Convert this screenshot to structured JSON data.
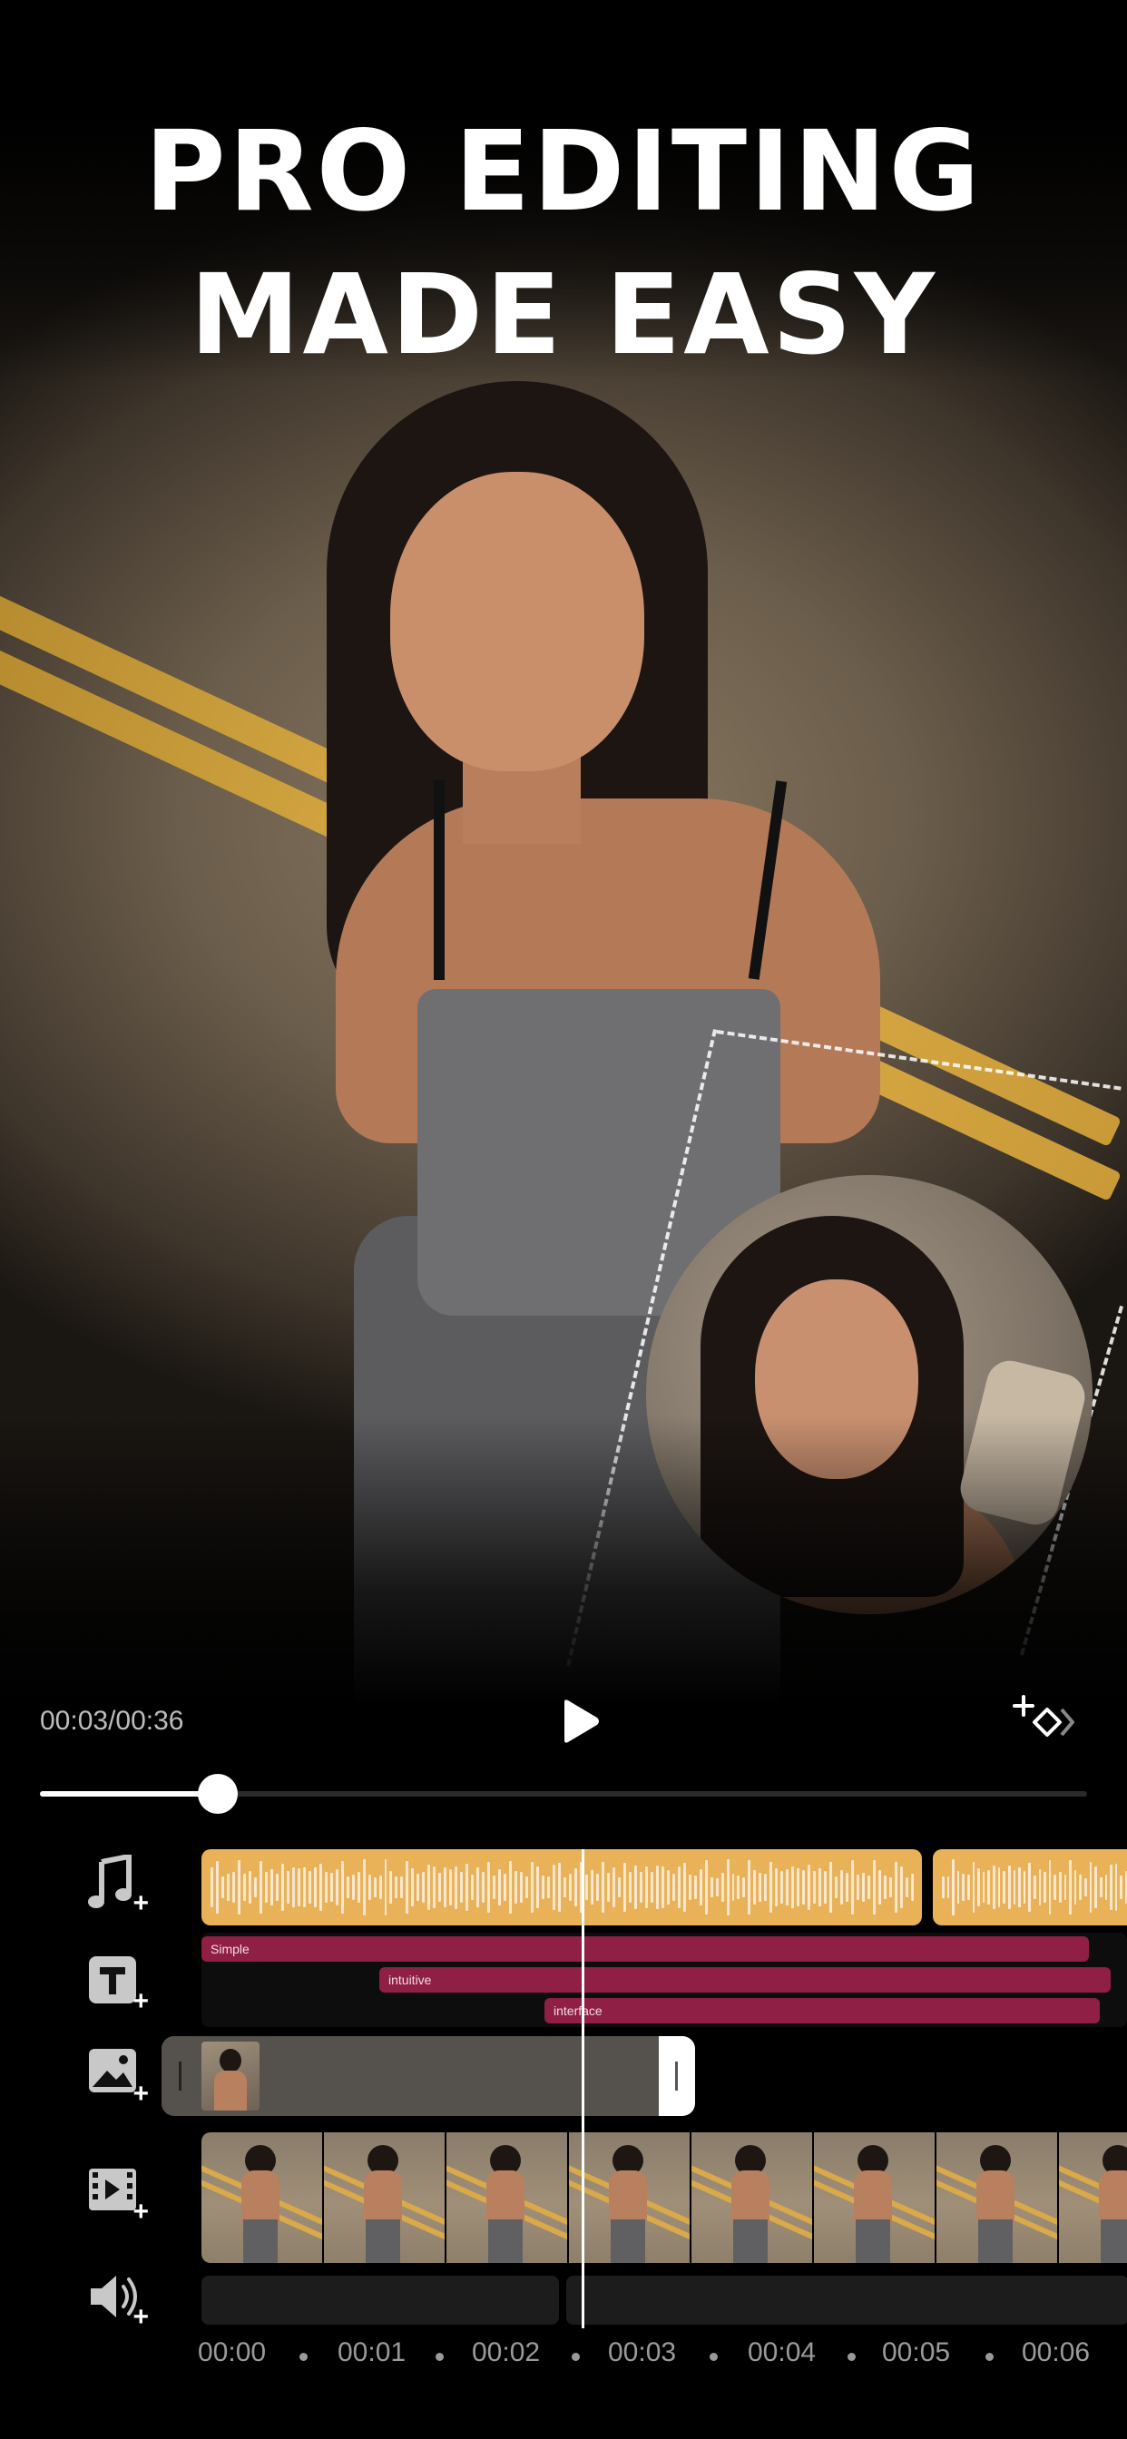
{
  "headline": {
    "line1": "PRO EDITING",
    "line2": "MADE EASY"
  },
  "player": {
    "timecode": "00:03/00:36",
    "progress_fraction": 0.17
  },
  "tracks": {
    "text_clips": [
      {
        "label": "Simple"
      },
      {
        "label": "intuitive"
      },
      {
        "label": "interface"
      }
    ]
  },
  "ruler": {
    "ticks": [
      "00:00",
      "00:01",
      "00:02",
      "00:03",
      "00:04",
      "00:05",
      "00:06"
    ]
  },
  "icons": {
    "play": "play-icon",
    "keyframe": "add-keyframe-icon",
    "music": "music-note-icon",
    "text": "text-icon",
    "image": "image-icon",
    "video": "video-icon",
    "volume": "volume-icon"
  },
  "colors": {
    "audio_clip": "#e9b259",
    "text_clip": "#8f1f45",
    "overlay_clip": "#55524d"
  }
}
